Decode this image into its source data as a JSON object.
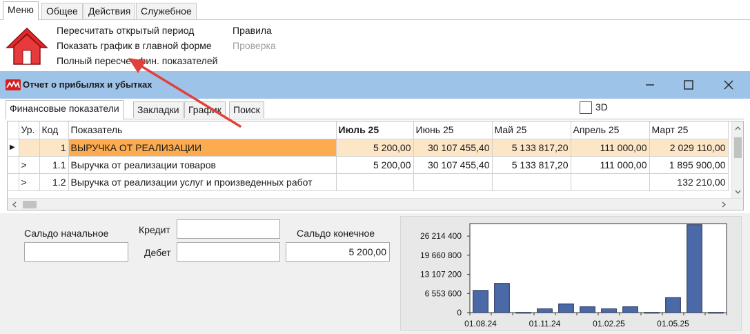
{
  "ribbon": {
    "tabs": [
      "Меню",
      "Общее",
      "Действия",
      "Служебное"
    ],
    "commands": {
      "recalc_period": "Пересчитать открытый период",
      "show_chart": "Показать график в главной форме",
      "full_recalc": "Полный пересчет фин. показателей",
      "rules": "Правила",
      "check": "Проверка"
    },
    "home_icon": "home-icon"
  },
  "window": {
    "title": "Отчет о прибылях и убытках",
    "controls": [
      "minimize-icon",
      "maximize-icon",
      "close-icon"
    ]
  },
  "form_tabs": [
    "Финансовые показатели",
    "Закладки",
    "График",
    "Поиск"
  ],
  "options": {
    "label_3d": "3D",
    "checked_3d": false
  },
  "grid": {
    "columns": [
      "Ур.",
      "Код",
      "Показатель",
      "Июль 25",
      "Июнь 25",
      "Май 25",
      "Апрель 25",
      "Март 25"
    ],
    "rows": [
      {
        "marker": "▶",
        "level": "",
        "code": "1",
        "name": "ВЫРУЧКА ОТ РЕАЛИЗАЦИИ",
        "values": [
          "5 200,00",
          "30 107 455,40",
          "5 133 817,20",
          "111 000,00",
          "2 029 110,00"
        ],
        "selected": true
      },
      {
        "marker": "",
        "level": ">",
        "code": "1.1",
        "name": "Выручка от реализации товаров",
        "values": [
          "5 200,00",
          "30 107 455,40",
          "5 133 817,20",
          "111 000,00",
          "1 895 900,00"
        ],
        "selected": false
      },
      {
        "marker": "",
        "level": ">",
        "code": "1.2",
        "name": "Выручка от реализации услуг и произведенных работ",
        "values": [
          "",
          "",
          "",
          "",
          "132 210,00"
        ],
        "selected": false
      }
    ]
  },
  "balance": {
    "start_label": "Сальдо начальное",
    "start_value": "",
    "credit_label": "Кредит",
    "credit_value": "",
    "debit_label": "Дебет",
    "debit_value": "",
    "end_label": "Сальдо конечное",
    "end_value": "5 200,00"
  },
  "chart_data": {
    "type": "bar",
    "y_ticks": [
      "0",
      "6 553 600",
      "13 107 200",
      "19 660 800",
      "26 214 400"
    ],
    "y_tick_values": [
      0,
      6553600,
      13107200,
      19660800,
      26214400
    ],
    "x_ticks": [
      "01.08.24",
      "01.11.24",
      "01.02.25",
      "01.05.25"
    ],
    "x_tick_index": [
      0,
      3,
      6,
      9
    ],
    "ylim": [
      0,
      30500000
    ],
    "values": [
      7600000,
      10000000,
      50000,
      1300000,
      3000000,
      2000000,
      1300000,
      2000000,
      50000,
      5133817,
      30107455,
      50000
    ],
    "bar_color": "#4a69a6",
    "grid": false,
    "legend": "none"
  }
}
